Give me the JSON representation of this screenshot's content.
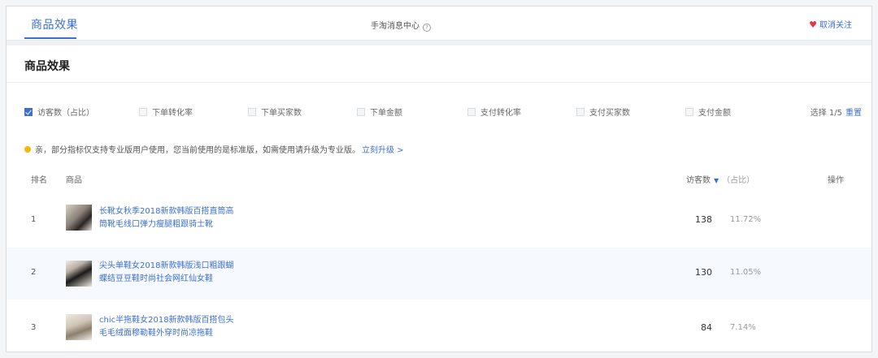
{
  "header": {
    "active_tab": "商品效果",
    "center_title": "手淘消息中心",
    "info_icon": "info-icon",
    "unfollow_label": "取消关注",
    "unfollow_icon": "heart-icon",
    "accent_color": "#3c6fd2"
  },
  "section": {
    "title": "商品效果"
  },
  "metrics": {
    "items": [
      {
        "label": "访客数（占比）",
        "checked": true
      },
      {
        "label": "下单转化率",
        "checked": false
      },
      {
        "label": "下单买家数",
        "checked": false
      },
      {
        "label": "下单金额",
        "checked": false
      },
      {
        "label": "支付转化率",
        "checked": false
      },
      {
        "label": "支付买家数",
        "checked": false
      },
      {
        "label": "支付金额",
        "checked": false
      }
    ],
    "selection": "选择 1/5",
    "reset": "重置"
  },
  "notice": {
    "text": "亲，部分指标仅支持专业版用户使用，您当前使用的是标准版，如需使用请升级为专业版。",
    "link": "立刻升级 >"
  },
  "table": {
    "headers": {
      "rank": "排名",
      "product": "商品",
      "visits": "访客数",
      "share": "（占比）",
      "action": "操作"
    },
    "rows": [
      {
        "rank": "1",
        "name_line1": "长靴女秋季2018新款韩版百搭直筒高",
        "name_line2": "筒靴毛线口弹力瘦腿粗跟骑士靴",
        "visits": "138",
        "share": "11.72%"
      },
      {
        "rank": "2",
        "name_line1": "尖头单鞋女2018新款韩版浅口粗跟蝴",
        "name_line2": "蝶结豆豆鞋时尚社会网红仙女鞋",
        "visits": "130",
        "share": "11.05%"
      },
      {
        "rank": "3",
        "name_line1": "chic半拖鞋女2018新款韩版百搭包头",
        "name_line2": "毛毛绒面穆勒鞋外穿时尚凉拖鞋",
        "visits": "84",
        "share": "7.14%"
      }
    ]
  }
}
